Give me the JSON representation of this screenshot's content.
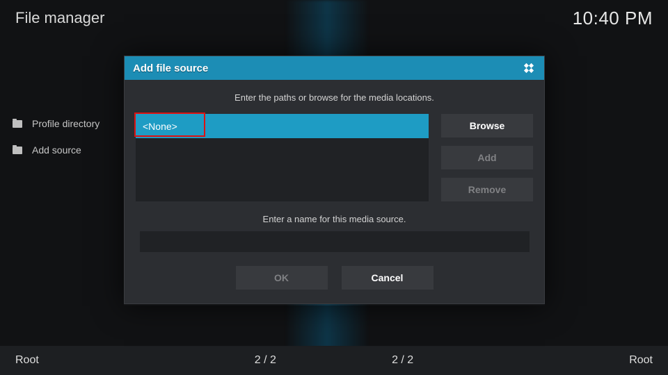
{
  "header": {
    "title": "File manager",
    "clock": "10:40 PM"
  },
  "sidebar": {
    "items": [
      {
        "label": "Profile directory"
      },
      {
        "label": "Add source"
      }
    ]
  },
  "dialog": {
    "title": "Add file source",
    "hint_paths": "Enter the paths or browse for the media locations.",
    "path_value": "<None>",
    "browse_label": "Browse",
    "add_label": "Add",
    "remove_label": "Remove",
    "hint_name": "Enter a name for this media source.",
    "name_value": "",
    "ok_label": "OK",
    "cancel_label": "Cancel"
  },
  "footer": {
    "left_label": "Root",
    "left_count": "2 / 2",
    "right_count": "2 / 2",
    "right_label": "Root"
  }
}
